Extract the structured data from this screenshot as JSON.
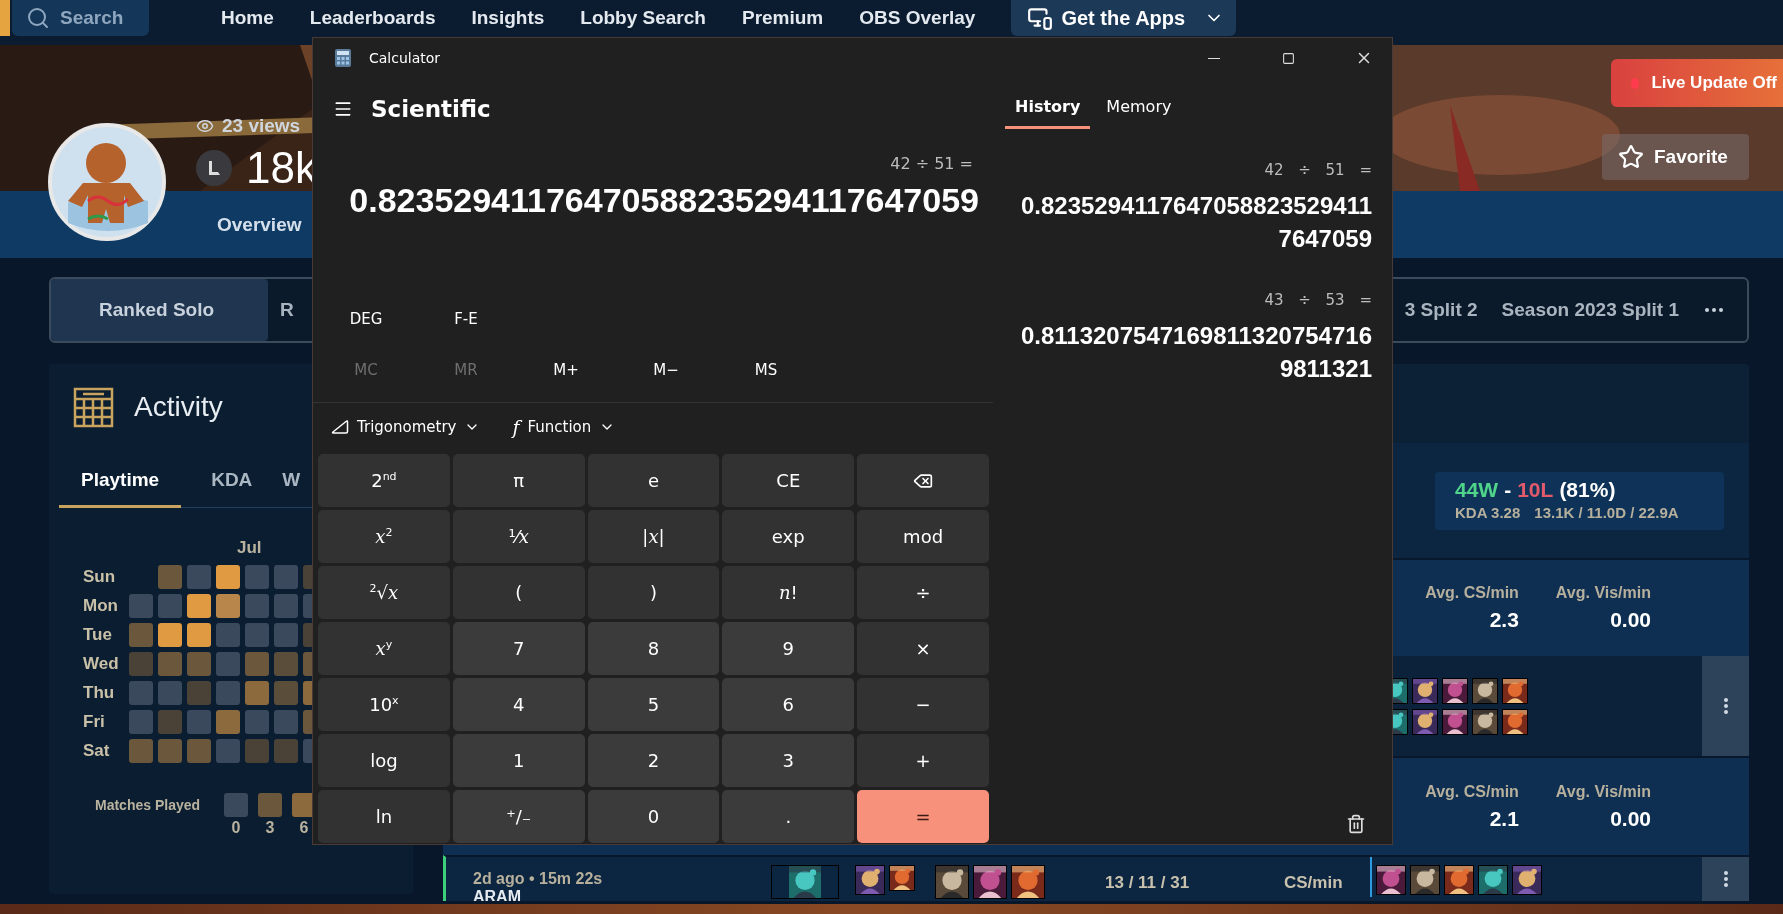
{
  "nav": {
    "search_placeholder": "Search",
    "links": [
      "Home",
      "Leaderboards",
      "Insights",
      "Lobby Search",
      "Premium",
      "OBS Overlay"
    ],
    "apps_button": "Get the Apps"
  },
  "profile": {
    "views": "23 views",
    "name": "18k",
    "tab": "Overview",
    "live_update": {
      "label": "Live Update Off",
      "on": false
    },
    "favorite": "Favorite"
  },
  "seasons": {
    "left": [
      {
        "label": "Ranked Solo",
        "selected": true
      },
      {
        "label": "R",
        "selected": false
      }
    ],
    "right": [
      {
        "label": "3 Split 2",
        "selected": false
      },
      {
        "label": "Season 2023 Split 1",
        "selected": false
      }
    ]
  },
  "activity": {
    "title": "Activity",
    "tabs": [
      {
        "label": "Playtime",
        "selected": true
      },
      {
        "label": "KDA",
        "selected": false
      },
      {
        "label": "W",
        "selected": false
      }
    ],
    "month": "Jul",
    "days": [
      {
        "label": "Sun",
        "cells": [
          null,
          {
            "color": "#6b573c"
          },
          {
            "color": "#3a4a5c"
          },
          {
            "color": "#e09b42"
          },
          {
            "color": "#3a4a5c"
          },
          {
            "color": "#3a4a5c"
          },
          {
            "color": "#4a4236"
          }
        ]
      },
      {
        "label": "Mon",
        "cells": [
          {
            "color": "#3a4a5c"
          },
          {
            "color": "#3a4a5c"
          },
          {
            "color": "#e09b42"
          },
          {
            "color": "#b8864a"
          },
          {
            "color": "#3a4a5c"
          },
          {
            "color": "#3a4a5c"
          },
          {
            "color": "#3a4a5c"
          }
        ]
      },
      {
        "label": "Tue",
        "cells": [
          {
            "color": "#6b573c"
          },
          {
            "color": "#e09b42"
          },
          {
            "color": "#e09b42"
          },
          {
            "color": "#3a4a5c"
          },
          {
            "color": "#3a4a5c"
          },
          {
            "color": "#3a4a5c"
          },
          {
            "color": "#4a4236"
          }
        ]
      },
      {
        "label": "Wed",
        "cells": [
          {
            "color": "#4a4236"
          },
          {
            "color": "#6b573c"
          },
          {
            "color": "#6b573c"
          },
          {
            "color": "#3a4a5c"
          },
          {
            "color": "#6b573c"
          },
          {
            "color": "#5a4d3a"
          },
          {
            "color": "#6b573c"
          }
        ]
      },
      {
        "label": "Thu",
        "cells": [
          {
            "color": "#3a4a5c"
          },
          {
            "color": "#3a4a5c"
          },
          {
            "color": "#4a4236"
          },
          {
            "color": "#3a4a5c"
          },
          {
            "color": "#8c6a3e"
          },
          {
            "color": "#5a4d3a"
          },
          {
            "color": "#8c6a3e"
          }
        ]
      },
      {
        "label": "Fri",
        "cells": [
          {
            "color": "#3a4a5c"
          },
          {
            "color": "#4a4236"
          },
          {
            "color": "#3a4a5c"
          },
          {
            "color": "#8c6a3e"
          },
          {
            "color": "#3a4a5c"
          },
          {
            "color": "#3a4a5c"
          },
          {
            "color": "#6b573c"
          }
        ]
      },
      {
        "label": "Sat",
        "cells": [
          {
            "color": "#6b573c"
          },
          {
            "color": "#6b573c"
          },
          {
            "color": "#6b573c"
          },
          {
            "color": "#3a4a5c"
          },
          {
            "color": "#4a4236"
          },
          {
            "color": "#4a4236"
          },
          {
            "color": "#3a4a5c"
          }
        ]
      }
    ],
    "legend": {
      "label": "Matches Played",
      "steps": [
        {
          "label": "0",
          "color": "#3a4a5c"
        },
        {
          "label": "3",
          "color": "#6b573c"
        },
        {
          "label": "6",
          "color": "#8c6a3e"
        }
      ]
    }
  },
  "summary": {
    "wins": "44W",
    "separator": "-",
    "losses": "10L",
    "rate": "(81%)",
    "kda": "KDA 3.28",
    "kda_detail": "13.1K / 11.0D / 22.9A"
  },
  "matches": [
    {
      "kind": "stats",
      "stats": [
        {
          "label": "Avg. CS/min",
          "value": "2.3"
        },
        {
          "label": "Avg. Vis/min",
          "value": "0.00"
        }
      ]
    },
    {
      "kind": "champions"
    },
    {
      "kind": "stats",
      "stats": [
        {
          "label": "Avg. CS/min",
          "value": "2.1"
        },
        {
          "label": "Avg. Vis/min",
          "value": "0.00"
        }
      ]
    },
    {
      "kind": "match",
      "time": "2d ago • 15m 22s",
      "mode": "ARAM",
      "kda": "13 / 11 / 31",
      "cs": "CS/min"
    }
  ],
  "calculator": {
    "title": "Calculator",
    "mode": "Scientific",
    "expression": "42 ÷ 51 =",
    "result": "0.82352941176470588235294117647059",
    "angle": "DEG",
    "notation": "F-E",
    "memory_keys": [
      {
        "label": "MC",
        "disabled": true
      },
      {
        "label": "MR",
        "disabled": true
      },
      {
        "label": "M+",
        "disabled": false
      },
      {
        "label": "M−",
        "disabled": false
      },
      {
        "label": "MS",
        "disabled": false
      }
    ],
    "menus": [
      {
        "label": "Trigonometry",
        "kind": "trig"
      },
      {
        "label": "Function",
        "kind": "func",
        "icon": "f"
      }
    ],
    "keys": [
      {
        "label": "2$^{nd}$",
        "kind": "fn"
      },
      {
        "label": "π",
        "kind": "fn"
      },
      {
        "label": "e",
        "kind": "fn"
      },
      {
        "label": "CE",
        "kind": "fn"
      },
      {
        "kind": "backspace"
      },
      {
        "label": "*x*$^{2}$",
        "kind": "fn"
      },
      {
        "label": "¹⁄*x*",
        "kind": "fn"
      },
      {
        "label": "|*x*|",
        "kind": "fn"
      },
      {
        "label": "exp",
        "kind": "fn"
      },
      {
        "label": "mod",
        "kind": "fn"
      },
      {
        "label": "$^{2}$√*x*",
        "kind": "fn"
      },
      {
        "label": "(",
        "kind": "fn"
      },
      {
        "label": ")",
        "kind": "fn"
      },
      {
        "label": "*n*!",
        "kind": "fn"
      },
      {
        "label": "÷",
        "kind": "fn"
      },
      {
        "label": "*x*$^{y}$",
        "kind": "fn"
      },
      {
        "label": "7",
        "kind": "num"
      },
      {
        "label": "8",
        "kind": "num"
      },
      {
        "label": "9",
        "kind": "num"
      },
      {
        "label": "×",
        "kind": "fn"
      },
      {
        "label": "10$^{x}$",
        "kind": "fn"
      },
      {
        "label": "4",
        "kind": "num"
      },
      {
        "label": "5",
        "kind": "num"
      },
      {
        "label": "6",
        "kind": "num"
      },
      {
        "label": "−",
        "kind": "fn"
      },
      {
        "label": "log",
        "kind": "fn"
      },
      {
        "label": "1",
        "kind": "num"
      },
      {
        "label": "2",
        "kind": "num"
      },
      {
        "label": "3",
        "kind": "num"
      },
      {
        "label": "+",
        "kind": "fn"
      },
      {
        "label": "ln",
        "kind": "fn"
      },
      {
        "label": "⁺/₋",
        "kind": "num"
      },
      {
        "label": "0",
        "kind": "num"
      },
      {
        "label": ".",
        "kind": "num"
      },
      {
        "label": "=",
        "kind": "equals"
      }
    ],
    "panel_tabs": [
      {
        "label": "History",
        "selected": true
      },
      {
        "label": "Memory",
        "selected": false
      }
    ],
    "history": [
      {
        "expression": "42 ÷ 51 =",
        "result": "0.82352941176470588235294117647059"
      },
      {
        "expression": "43 ÷ 53 =",
        "result": "0.81132075471698113207547169811321"
      }
    ]
  }
}
